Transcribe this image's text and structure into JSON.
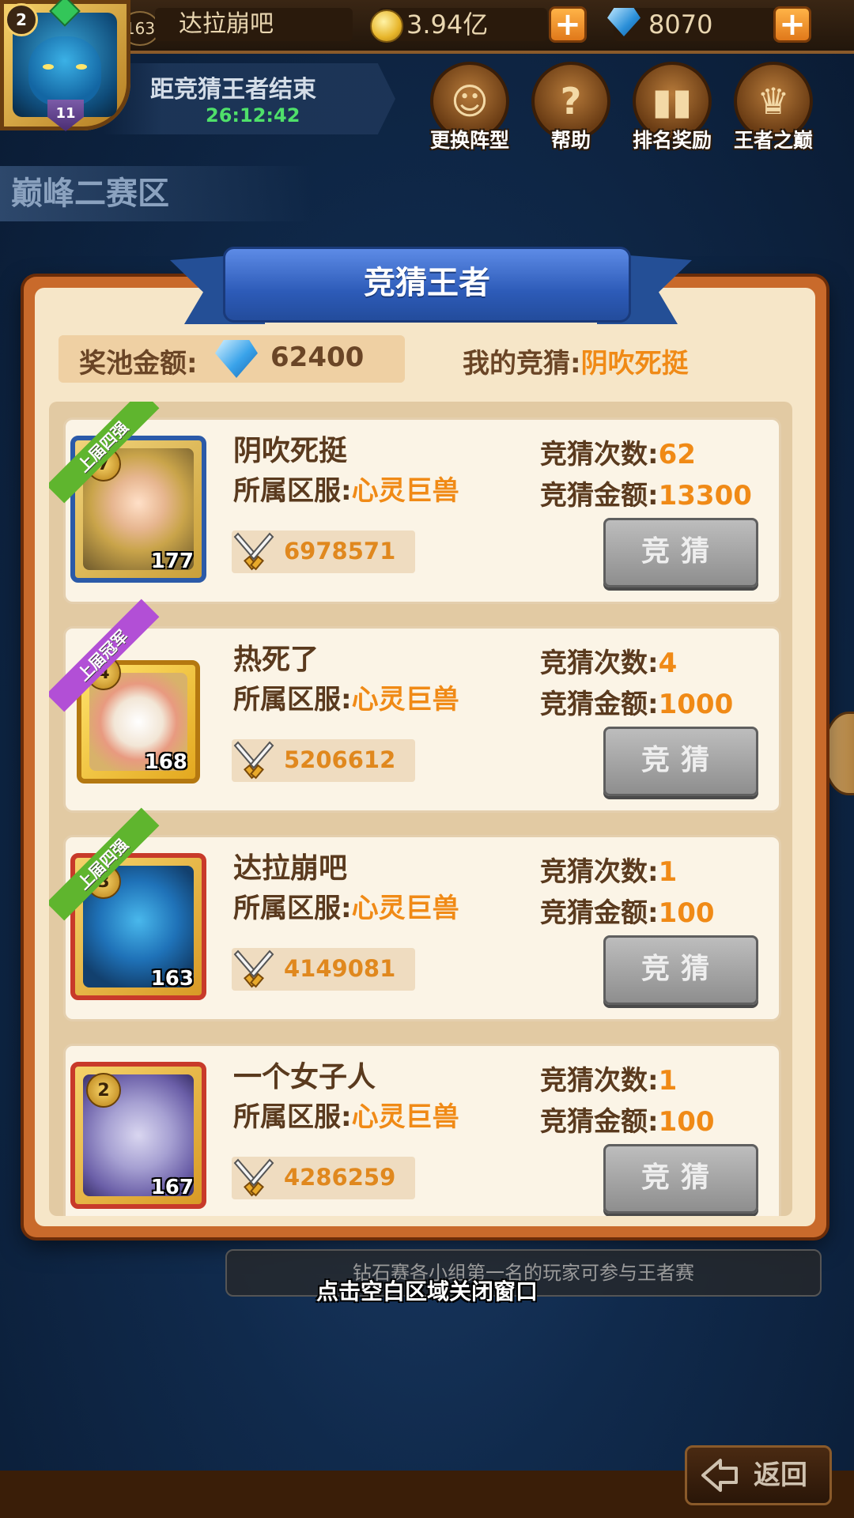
{
  "top_bar": {
    "avatar_badge": "2",
    "avatar_rank": "11",
    "player_level": "163",
    "player_name": "达拉崩吧",
    "gold": "3.94亿",
    "diamonds": "8070",
    "plus": "+"
  },
  "countdown": {
    "label": "距竞猜王者结束",
    "time": "26:12:42"
  },
  "actions": [
    {
      "label": "更换阵型",
      "icon": "face-icon"
    },
    {
      "label": "帮助",
      "icon": "question-icon"
    },
    {
      "label": "排名奖励",
      "icon": "bar-chart-icon"
    },
    {
      "label": "王者之巅",
      "icon": "trophy-icon"
    }
  ],
  "zone": "巅峰二赛区",
  "modal": {
    "title": "竞猜王者",
    "pool_label": "奖池金额:",
    "pool_value": "62400",
    "my_guess_label": "我的竞猜:",
    "my_guess_value": "阴吹死挺",
    "server_label": "所属区服:",
    "count_label": "竞猜次数:",
    "amount_label": "竞猜金额:",
    "bet_button": "竞猜",
    "players": [
      {
        "tag": "上届四强",
        "tag_color": "#5fb52e",
        "stars": "7",
        "level": "177",
        "name": "阴吹死挺",
        "server": "心灵巨兽",
        "power": "6978571",
        "count": "62",
        "amount": "13300"
      },
      {
        "tag": "上届冠军",
        "tag_color": "#b24fd6",
        "stars": "4",
        "level": "168",
        "name": "热死了",
        "server": "心灵巨兽",
        "power": "5206612",
        "count": "4",
        "amount": "1000"
      },
      {
        "tag": "上届四强",
        "tag_color": "#5fb52e",
        "stars": "3",
        "level": "163",
        "name": "达拉崩吧",
        "server": "心灵巨兽",
        "power": "4149081",
        "count": "1",
        "amount": "100"
      },
      {
        "tag": "",
        "tag_color": "",
        "stars": "2",
        "level": "167",
        "name": "一个女子人",
        "server": "心灵巨兽",
        "power": "4286259",
        "count": "1",
        "amount": "100"
      }
    ]
  },
  "notice": "钻石赛各小组第一名的玩家可参与王者赛",
  "close_hint": "点击空白区域关闭窗口",
  "back_button": "返回",
  "colors": {
    "accent_orange": "#f08a16",
    "ribbon_blue": "#2d5bb8",
    "modal_border": "#c96a2b"
  }
}
